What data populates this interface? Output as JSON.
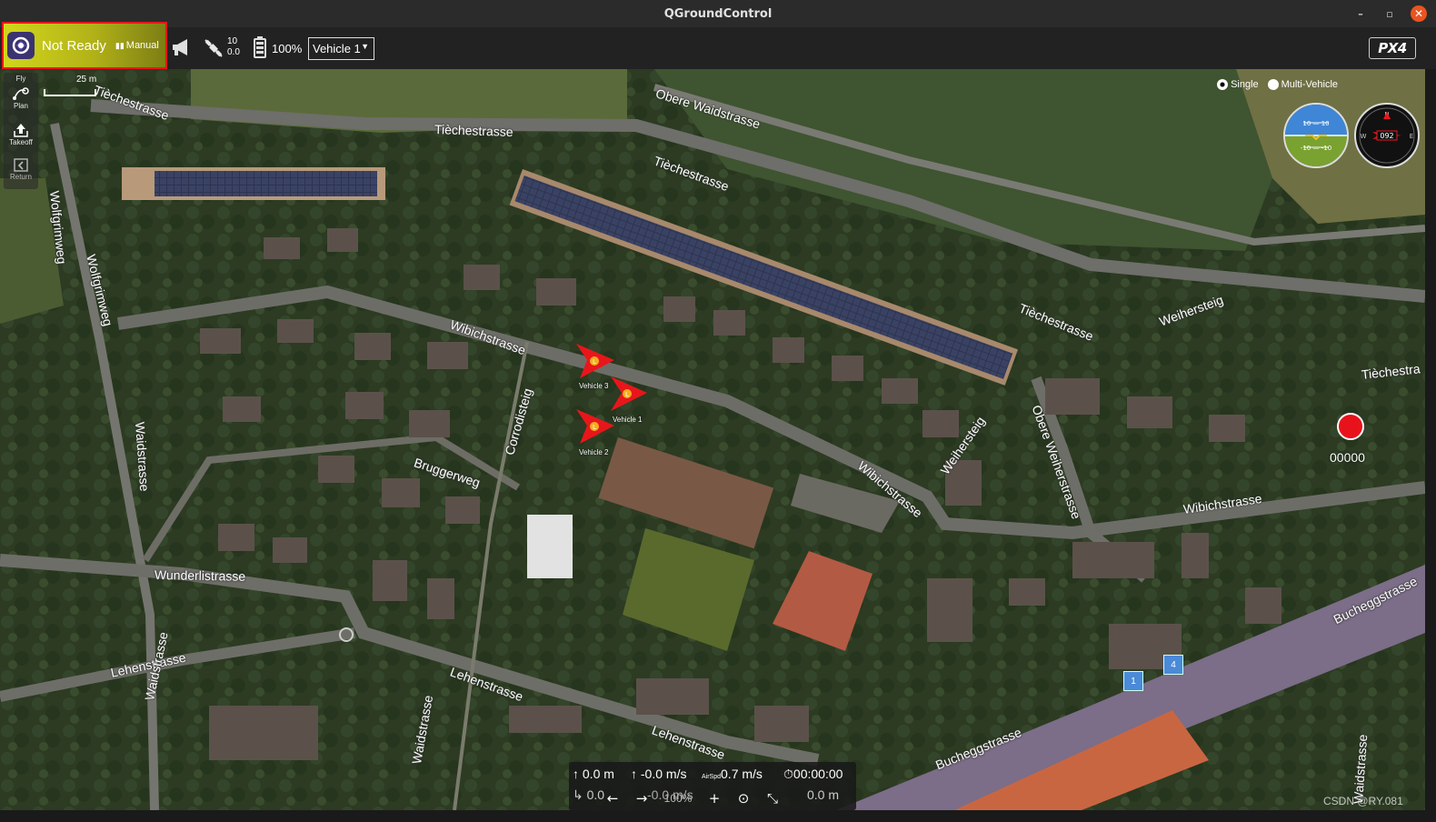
{
  "window": {
    "title": "QGroundControl",
    "controls": [
      "–",
      "▫",
      "✕"
    ]
  },
  "toolbar": {
    "status": "Not Ready",
    "mode": "Manual",
    "gps_sats": "10",
    "gps_hdop": "0.0",
    "battery": "100%",
    "vehicle_selected": "Vehicle 1",
    "brand_logo": "PX4"
  },
  "toolstrip": [
    {
      "label": "Fly",
      "icon": "fly-icon"
    },
    {
      "label": "Plan",
      "icon": "plan-icon"
    },
    {
      "label": "Takeoff",
      "icon": "takeoff-icon"
    },
    {
      "label": "Return",
      "icon": "return-icon"
    }
  ],
  "map": {
    "scale_label": "25 m",
    "roads": [
      "Tièchestrasse",
      "Tièchestrasse",
      "Obere Waidstrasse",
      "Tièchestrasse",
      "Wolfgrimweg",
      "Wolfgrimweg",
      "Wibichstrasse",
      "Waidstrasse",
      "Corrodisteig",
      "Bruggerweg",
      "Wunderlistrasse",
      "Lehenstrasse",
      "Lehenstrasse",
      "Lehenstrasse",
      "Waidstrasse",
      "Waidstrasse",
      "Wibichstrasse",
      "Weihersteig",
      "Obere Weiherstrasse",
      "Wibichstrasse",
      "Tièchestrasse",
      "Weihersteig",
      "Tièchestra",
      "Bucheggstrasse",
      "Bucheggstrasse",
      "Waidstrasse"
    ],
    "vehicles": [
      {
        "label": "Vehicle 3"
      },
      {
        "label": "Vehicle 1"
      },
      {
        "label": "Vehicle 2"
      }
    ],
    "badges": [
      "1",
      "4"
    ]
  },
  "multi_vehicle": {
    "single_label": "Single",
    "multi_label": "Multi-Vehicle"
  },
  "instruments": {
    "attitude_top": "10 — 10",
    "attitude_bottom": "-10 — -10",
    "compass_heading": "092",
    "compass_n": "N",
    "compass_e": "E",
    "compass_w": "W"
  },
  "video": {
    "counter": "00000"
  },
  "telemetry": {
    "altitude": "0.0 m",
    "vertical_speed": "-0.0 m/s",
    "airspeed_label": "AirSpd",
    "airspeed": "0.7 m/s",
    "flight_time": "00:00:00",
    "row2_left": "0.0",
    "row2_speed": "-0.0 m/s",
    "row2_dist": "0.0 m"
  },
  "map_controls": {
    "zoom": "100%"
  },
  "watermark": "CSDN @RY.081",
  "colors": {
    "status_bg": "#d2d61c",
    "highlight_border": "#e8161b",
    "vehicle": "#e8161b",
    "record": "#e8121b"
  }
}
